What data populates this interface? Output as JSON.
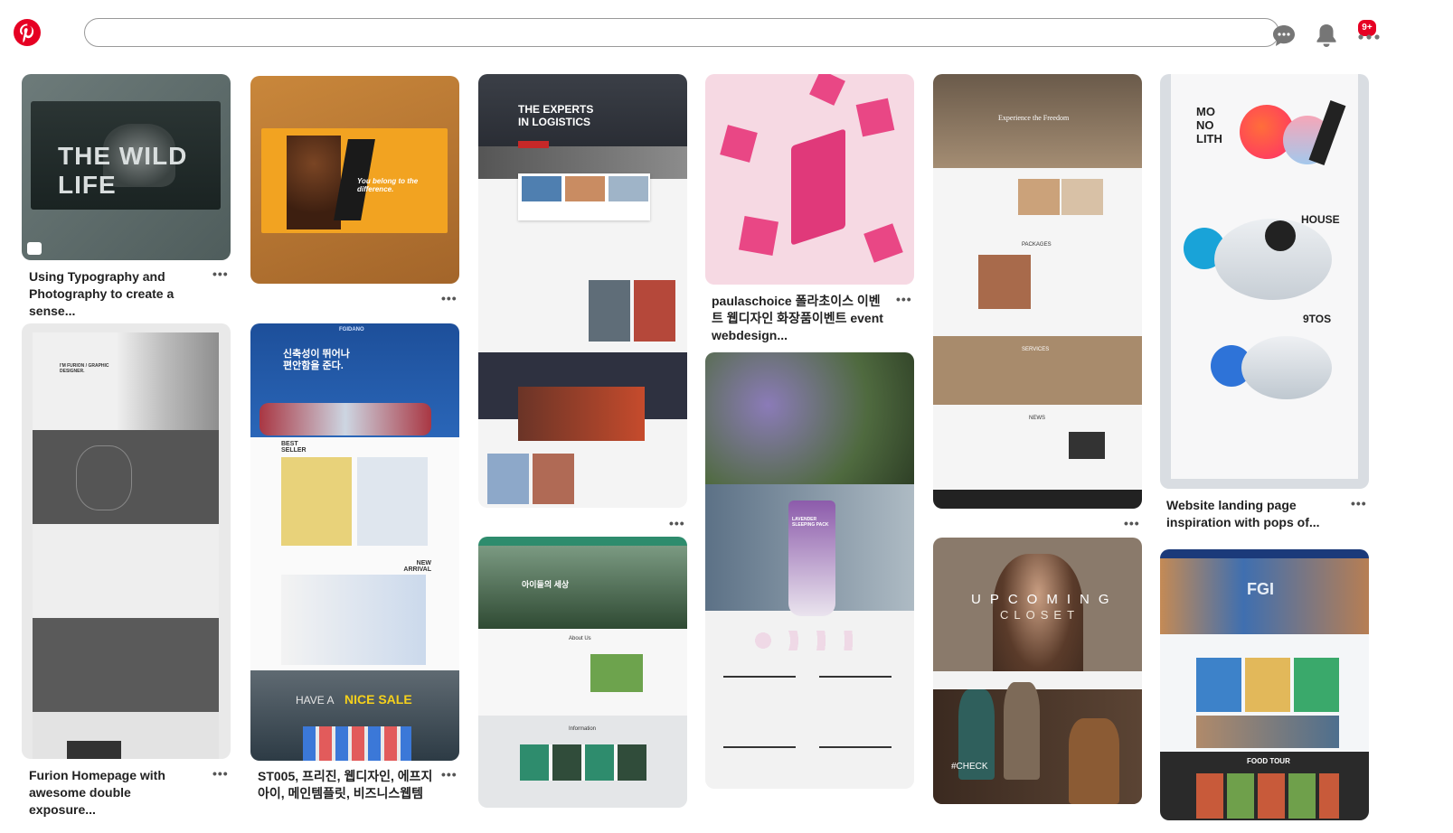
{
  "header": {
    "search_placeholder": "",
    "notification_badge": "9+",
    "icons": [
      "pinterest-logo-icon",
      "chat-icon",
      "bell-icon",
      "more-icon"
    ],
    "brand_color": "#e60023"
  },
  "pins": {
    "wildlife": {
      "overlay_title": "THE WILD LIFE",
      "caption": "Using Typography and Photography to create a sense..."
    },
    "orange_model": {
      "overlay_text": "You belong to the difference."
    },
    "logistics": {
      "overlay_title": "THE EXPERTS IN LOGISTICS"
    },
    "gifts": {
      "caption": "paulaschoice 폴라초이스 이벤트 웹디자인 화장품이벤트 event webdesign..."
    },
    "hotel": {
      "overlay_title": "Experience the Freedom",
      "section1": "PACKAGES",
      "section2": "SERVICES",
      "section3": "NEWS"
    },
    "monolith": {
      "overlay_title": "MO NO LITH",
      "word2": "HOUSE",
      "word3": "9TOS",
      "caption": "Website landing page inspiration with pops of..."
    },
    "furion": {
      "label": "I'M FURION / GRAPHIC DESIGNER.",
      "caption": "Furion Homepage with awesome double exposure..."
    },
    "fgidano": {
      "brand": "FGIDANO",
      "headline": "신축성이 뛰어나 편안함을 준다.",
      "best": "BEST SELLER",
      "new": "NEW ARRIVAL",
      "sale_prefix": "HAVE A",
      "sale": "NICE SALE",
      "caption": "ST005, 프리진, 웹디자인, 에프지 아이, 메인템플릿, 비즈니스웹템"
    },
    "lavender": {
      "product": "LAVENDER SLEEPING PACK"
    },
    "upcoming": {
      "title": "UPCOMING",
      "subtitle": "CLOSET",
      "tag": "#CHECK"
    },
    "forest": {
      "headline": "아이들의 세상",
      "section1": "About Us",
      "section2": "Information"
    },
    "tour": {
      "title": "FOOD TOUR",
      "overlay": "FGI"
    }
  },
  "more_label": "•••"
}
